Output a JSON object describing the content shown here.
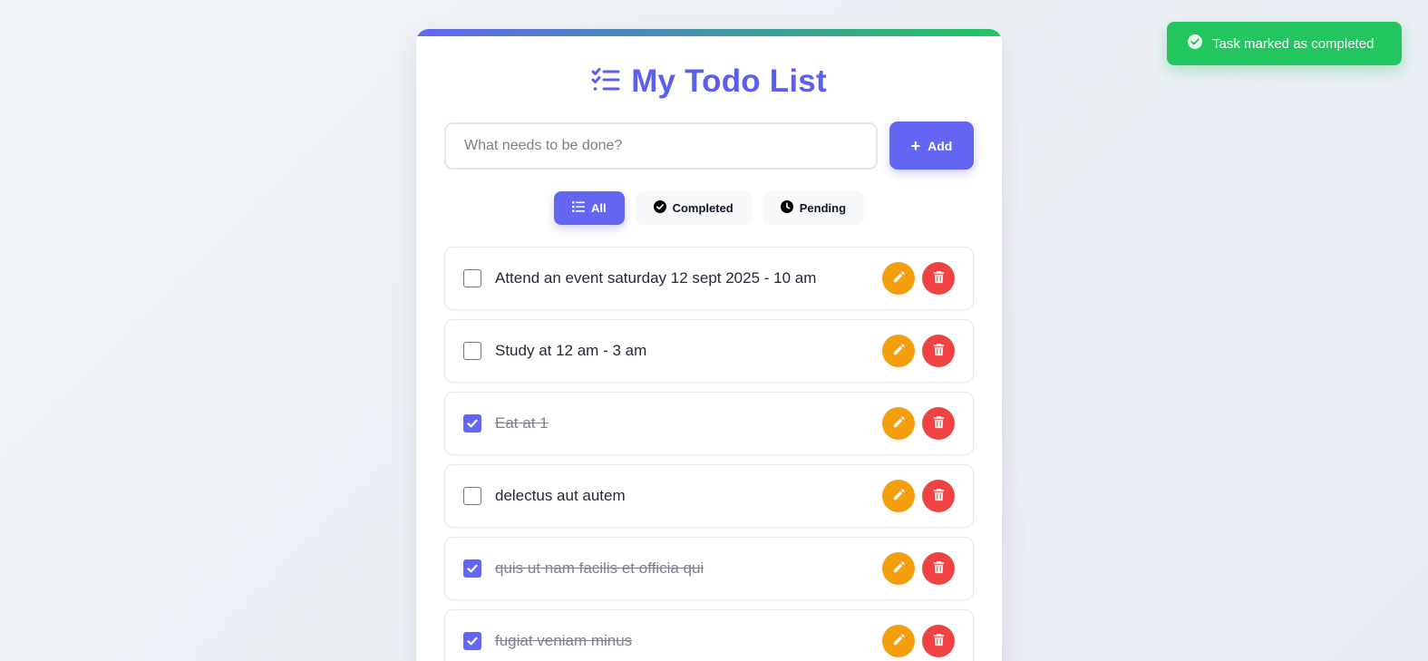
{
  "app": {
    "title": "My Todo List",
    "title_icon": "list-check-icon",
    "accent_color": "#6366f1",
    "title_color": "#5b5ff0"
  },
  "input": {
    "value": "",
    "placeholder": "What needs to be done?"
  },
  "add_button": {
    "label": "Add",
    "icon": "plus-icon"
  },
  "filters": [
    {
      "label": "All",
      "icon": "list-icon",
      "active": true
    },
    {
      "label": "Completed",
      "icon": "check-circle-icon",
      "active": false
    },
    {
      "label": "Pending",
      "icon": "clock-icon",
      "active": false
    }
  ],
  "todos": [
    {
      "text": "Attend an event saturday 12 sept 2025 - 10 am",
      "completed": false
    },
    {
      "text": "Study at 12 am - 3 am",
      "completed": false
    },
    {
      "text": "Eat at 1",
      "completed": true
    },
    {
      "text": "delectus aut autem",
      "completed": false
    },
    {
      "text": "quis ut nam facilis et officia qui",
      "completed": true
    },
    {
      "text": "fugiat veniam minus",
      "completed": true
    }
  ],
  "toast": {
    "message": "Task marked as completed",
    "icon": "check-circle-icon",
    "color": "#22c55e"
  },
  "colors": {
    "edit": "#f59e0b",
    "delete": "#ef4444"
  }
}
